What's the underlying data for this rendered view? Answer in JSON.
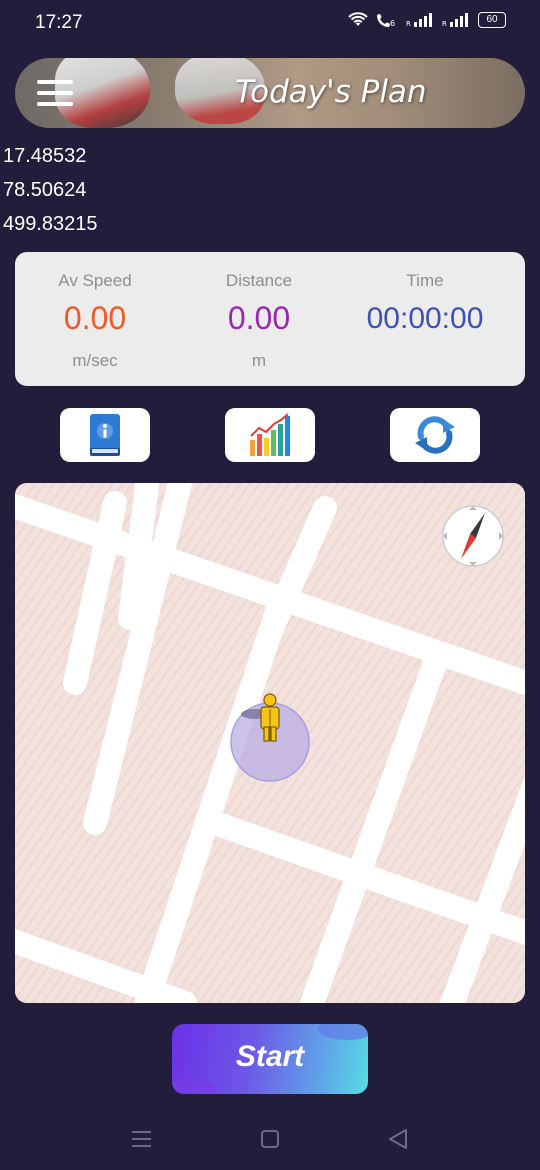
{
  "status_bar": {
    "time": "17:27",
    "battery": "60",
    "icons": [
      "wifi-icon",
      "volte-call-icon",
      "signal-icon-1",
      "signal-icon-2",
      "battery-icon"
    ]
  },
  "header": {
    "title": "Today's Plan",
    "menu_icon": "hamburger-menu-icon"
  },
  "coordinates": {
    "latitude": "17.48532",
    "longitude": "78.50624",
    "altitude": "499.83215"
  },
  "stats": {
    "speed": {
      "label": "Av Speed",
      "value": "0.00",
      "unit": "m/sec",
      "color": "#f05a28"
    },
    "distance": {
      "label": "Distance",
      "value": "0.00",
      "unit": "m",
      "color": "#9a27b0"
    },
    "time": {
      "label": "Time",
      "value": "00:00:00",
      "color": "#3f51b5"
    }
  },
  "actions": [
    {
      "name": "info-book-icon"
    },
    {
      "name": "bar-chart-icon"
    },
    {
      "name": "refresh-icon"
    }
  ],
  "map": {
    "background": "#f2e1dc",
    "road_color": "#ffffff",
    "icons": [
      "compass-icon",
      "pegman-icon"
    ]
  },
  "start_button": {
    "label": "Start"
  },
  "nav_bar": {
    "icons": [
      "menu-nav-icon",
      "home-nav-icon",
      "back-nav-icon"
    ]
  },
  "colors": {
    "background": "#221d3b",
    "card": "#ececec",
    "accent_start_from": "#6a31e6",
    "accent_start_to": "#56dde4"
  }
}
